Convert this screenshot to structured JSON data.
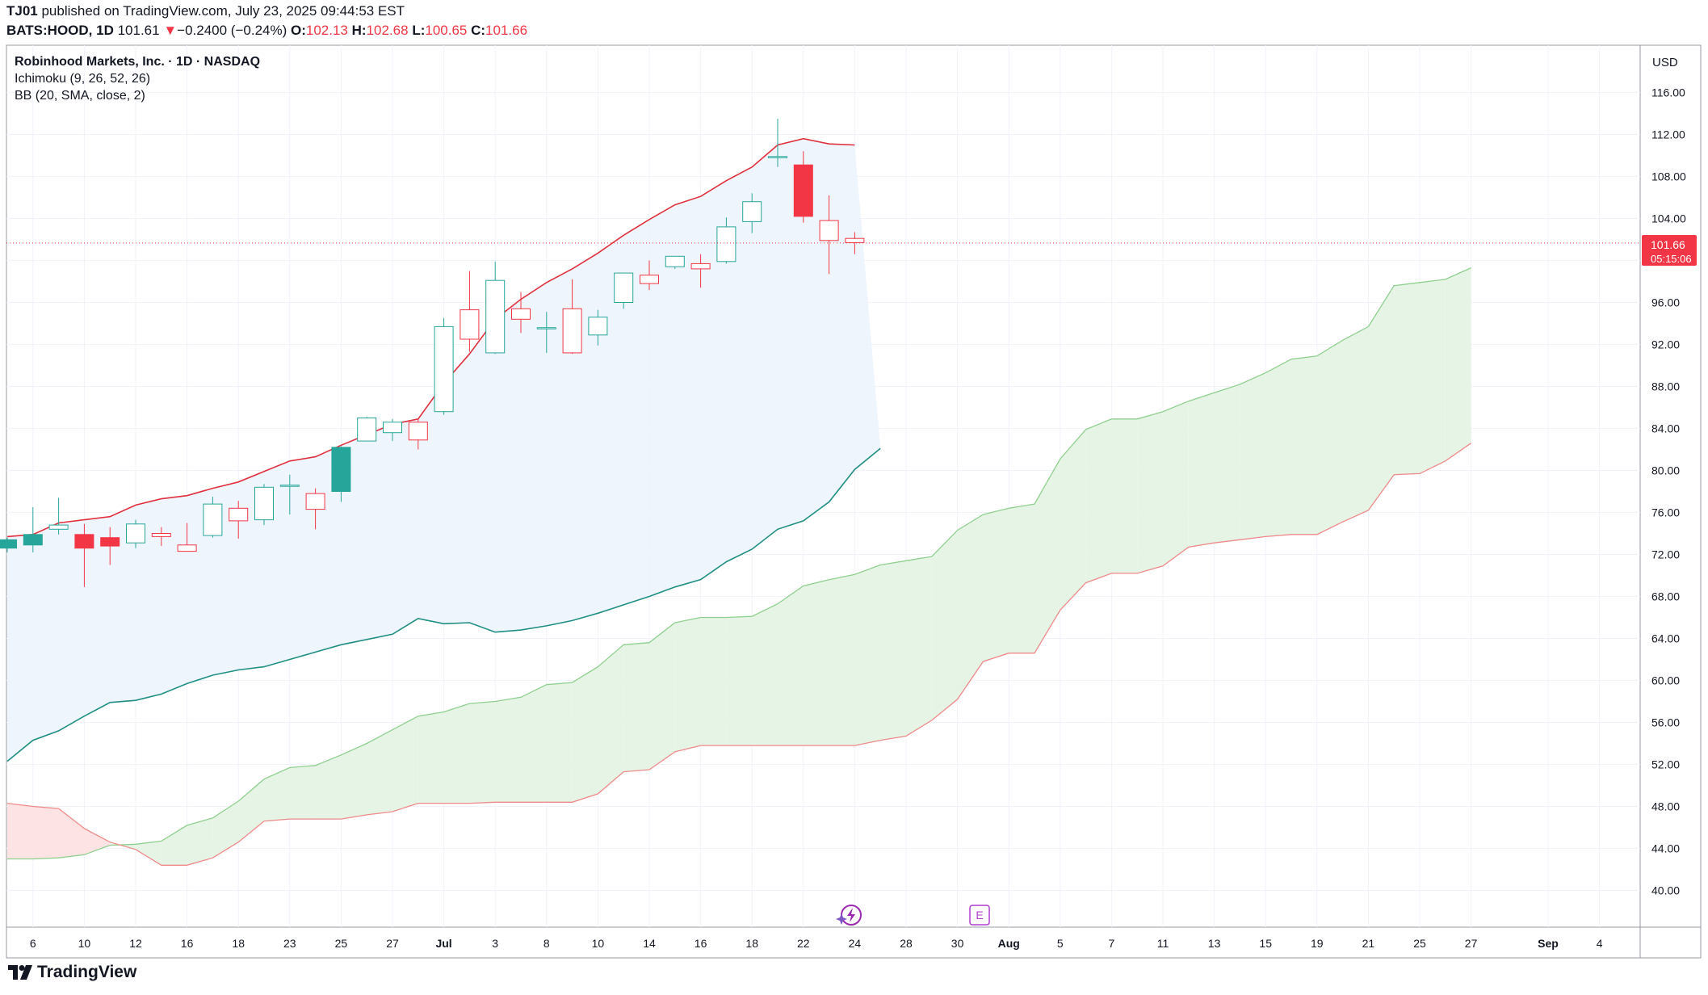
{
  "header": {
    "author": "TJ01",
    "published": " published on TradingView.com, July 23, 2025 09:44:53 EST"
  },
  "symbol_line": {
    "symbol": "BATS:HOOD, 1D",
    "last": "101.61",
    "arrow": "▼",
    "change": "−0.2400 (−0.24%)",
    "o_label": "O:",
    "o": "102.13",
    "h_label": "H:",
    "h": "102.68",
    "l_label": "L:",
    "l": "100.65",
    "c_label": "C:",
    "c": "101.66"
  },
  "legend": {
    "title": "Robinhood Markets, Inc. · 1D · NASDAQ",
    "ichimoku": "Ichimoku (9, 26, 52, 26)",
    "bb": "BB (20, SMA, close, 2)"
  },
  "price_axis": {
    "currency": "USD",
    "current_price": "101.66",
    "countdown": "05:15:06"
  },
  "footer": {
    "brand": "TradingView"
  },
  "events": {
    "earnings_label": "E"
  },
  "colors": {
    "up": "#26a69a",
    "down": "#f23645",
    "bb_upper": "#e0303d",
    "bb_lower": "#1f8f84",
    "cloud_bull": "#e6f4e6",
    "cloud_bear": "#fde3e3",
    "bb_fill": "#edf4fc",
    "earnings": "#b23fd0"
  },
  "chart_data": {
    "type": "candlestick",
    "ylim": [
      36.5,
      120.5
    ],
    "y_ticks": [
      "116.00",
      "112.00",
      "108.00",
      "104.00",
      "100.00",
      "96.00",
      "92.00",
      "88.00",
      "84.00",
      "80.00",
      "76.00",
      "72.00",
      "68.00",
      "64.00",
      "60.00",
      "56.00",
      "52.00",
      "48.00",
      "44.00",
      "40.00"
    ],
    "x_ticks": [
      {
        "i": 1,
        "label": "6"
      },
      {
        "i": 3,
        "label": "10"
      },
      {
        "i": 5,
        "label": "12"
      },
      {
        "i": 7,
        "label": "16"
      },
      {
        "i": 9,
        "label": "18"
      },
      {
        "i": 11,
        "label": "23"
      },
      {
        "i": 13,
        "label": "25"
      },
      {
        "i": 15,
        "label": "27"
      },
      {
        "i": 17,
        "label": "Jul"
      },
      {
        "i": 19,
        "label": "3"
      },
      {
        "i": 21,
        "label": "8"
      },
      {
        "i": 23,
        "label": "10"
      },
      {
        "i": 25,
        "label": "14"
      },
      {
        "i": 27,
        "label": "16"
      },
      {
        "i": 29,
        "label": "18"
      },
      {
        "i": 31,
        "label": "22"
      },
      {
        "i": 33,
        "label": "24"
      },
      {
        "i": 35,
        "label": "28"
      },
      {
        "i": 37,
        "label": "30"
      },
      {
        "i": 39,
        "label": "Aug"
      },
      {
        "i": 41,
        "label": "5"
      },
      {
        "i": 43,
        "label": "7"
      },
      {
        "i": 45,
        "label": "11"
      },
      {
        "i": 47,
        "label": "13"
      },
      {
        "i": 49,
        "label": "15"
      },
      {
        "i": 51,
        "label": "19"
      },
      {
        "i": 53,
        "label": "21"
      },
      {
        "i": 55,
        "label": "25"
      },
      {
        "i": 57,
        "label": "27"
      },
      {
        "i": 60,
        "label": "Sep"
      },
      {
        "i": 62,
        "label": "4"
      }
    ],
    "candles": [
      {
        "o": 72.6,
        "h": 73.6,
        "l": 72.2,
        "c": 73.4
      },
      {
        "o": 72.9,
        "h": 76.5,
        "l": 72.2,
        "c": 73.9
      },
      {
        "o": 74.4,
        "h": 77.4,
        "l": 73.9,
        "c": 74.8
      },
      {
        "o": 73.9,
        "h": 74.9,
        "l": 68.9,
        "c": 72.6
      },
      {
        "o": 73.6,
        "h": 74.6,
        "l": 71.0,
        "c": 72.8
      },
      {
        "o": 73.1,
        "h": 75.3,
        "l": 72.6,
        "c": 74.9
      },
      {
        "o": 74.0,
        "h": 74.6,
        "l": 72.8,
        "c": 73.7
      },
      {
        "o": 72.9,
        "h": 75.0,
        "l": 72.3,
        "c": 72.3
      },
      {
        "o": 73.8,
        "h": 77.5,
        "l": 73.6,
        "c": 76.8
      },
      {
        "o": 76.4,
        "h": 77.1,
        "l": 73.5,
        "c": 75.2
      },
      {
        "o": 75.3,
        "h": 78.7,
        "l": 74.8,
        "c": 78.4
      },
      {
        "o": 78.5,
        "h": 79.6,
        "l": 75.8,
        "c": 78.6
      },
      {
        "o": 77.8,
        "h": 78.3,
        "l": 74.4,
        "c": 76.3
      },
      {
        "o": 78.0,
        "h": 82.3,
        "l": 77.0,
        "c": 82.2
      },
      {
        "o": 82.8,
        "h": 85.1,
        "l": 82.8,
        "c": 85.0
      },
      {
        "o": 83.6,
        "h": 84.9,
        "l": 82.8,
        "c": 84.6
      },
      {
        "o": 84.6,
        "h": 84.9,
        "l": 82.0,
        "c": 82.9
      },
      {
        "o": 85.6,
        "h": 94.5,
        "l": 85.3,
        "c": 93.7
      },
      {
        "o": 95.3,
        "h": 99.0,
        "l": 91.3,
        "c": 92.5
      },
      {
        "o": 91.2,
        "h": 99.9,
        "l": 91.1,
        "c": 98.1
      },
      {
        "o": 95.4,
        "h": 97.0,
        "l": 93.1,
        "c": 94.4
      },
      {
        "o": 93.6,
        "h": 95.1,
        "l": 91.2,
        "c": 93.6
      },
      {
        "o": 95.4,
        "h": 98.2,
        "l": 91.1,
        "c": 91.2
      },
      {
        "o": 92.9,
        "h": 95.3,
        "l": 91.9,
        "c": 94.6
      },
      {
        "o": 96.0,
        "h": 98.8,
        "l": 95.4,
        "c": 98.8
      },
      {
        "o": 98.6,
        "h": 100.0,
        "l": 97.2,
        "c": 97.8
      },
      {
        "o": 99.4,
        "h": 100.4,
        "l": 99.2,
        "c": 100.4
      },
      {
        "o": 99.7,
        "h": 100.6,
        "l": 97.4,
        "c": 99.2
      },
      {
        "o": 99.9,
        "h": 104.1,
        "l": 99.7,
        "c": 103.2
      },
      {
        "o": 103.7,
        "h": 106.4,
        "l": 102.6,
        "c": 105.6
      },
      {
        "o": 109.8,
        "h": 113.5,
        "l": 108.9,
        "c": 109.9
      },
      {
        "o": 109.1,
        "h": 110.4,
        "l": 103.6,
        "c": 104.2
      },
      {
        "o": 103.8,
        "h": 106.2,
        "l": 98.7,
        "c": 101.9
      },
      {
        "o": 102.1,
        "h": 102.7,
        "l": 100.6,
        "c": 101.7
      }
    ],
    "bb_upper": [
      73.7,
      73.9,
      75.0,
      75.3,
      75.6,
      76.7,
      77.3,
      77.6,
      78.3,
      78.9,
      79.9,
      80.9,
      81.3,
      82.4,
      83.4,
      84.4,
      84.9,
      88.3,
      91.1,
      94.4,
      96.3,
      97.9,
      99.2,
      100.7,
      102.4,
      103.9,
      105.3,
      106.1,
      107.6,
      108.9,
      111.0,
      111.6,
      111.1,
      111.0
    ],
    "bb_lower": [
      52.3,
      54.3,
      55.2,
      56.6,
      57.9,
      58.1,
      58.7,
      59.7,
      60.5,
      61.0,
      61.3,
      62.0,
      62.7,
      63.4,
      63.9,
      64.4,
      65.9,
      65.4,
      65.5,
      64.6,
      64.8,
      65.2,
      65.7,
      66.4,
      67.2,
      68.0,
      68.9,
      69.6,
      71.3,
      72.5,
      74.4,
      75.2,
      77.0,
      80.1,
      82.1
    ],
    "cloud_x_start": 0,
    "cloud_a": [
      43.0,
      43.0,
      43.1,
      43.4,
      44.3,
      44.4,
      44.7,
      46.2,
      46.9,
      48.5,
      50.6,
      51.7,
      51.9,
      52.9,
      54.0,
      55.3,
      56.6,
      57.0,
      57.8,
      58.0,
      58.4,
      59.6,
      59.8,
      61.3,
      63.4,
      63.6,
      65.5,
      66.0,
      66.0,
      66.1,
      67.3,
      69.0,
      69.6,
      70.1,
      71.0,
      71.4,
      71.8,
      74.3,
      75.8,
      76.4,
      76.8,
      81.1,
      83.9,
      84.9,
      84.9,
      85.6,
      86.6,
      87.4,
      88.2,
      89.3,
      90.6,
      90.9,
      92.4,
      93.7,
      97.6,
      97.9,
      98.2,
      99.3
    ],
    "cloud_b": [
      48.3,
      48.0,
      47.8,
      45.9,
      44.6,
      43.9,
      42.4,
      42.4,
      43.1,
      44.6,
      46.6,
      46.8,
      46.8,
      46.8,
      47.2,
      47.5,
      48.3,
      48.3,
      48.3,
      48.4,
      48.4,
      48.4,
      48.4,
      49.2,
      51.3,
      51.5,
      53.2,
      53.8,
      53.8,
      53.8,
      53.8,
      53.8,
      53.8,
      53.8,
      54.3,
      54.7,
      56.2,
      58.2,
      61.8,
      62.6,
      62.6,
      66.7,
      69.3,
      70.2,
      70.2,
      70.9,
      72.7,
      73.1,
      73.4,
      73.7,
      73.9,
      73.9,
      75.1,
      76.2,
      79.6,
      79.7,
      80.9,
      82.6
    ]
  }
}
